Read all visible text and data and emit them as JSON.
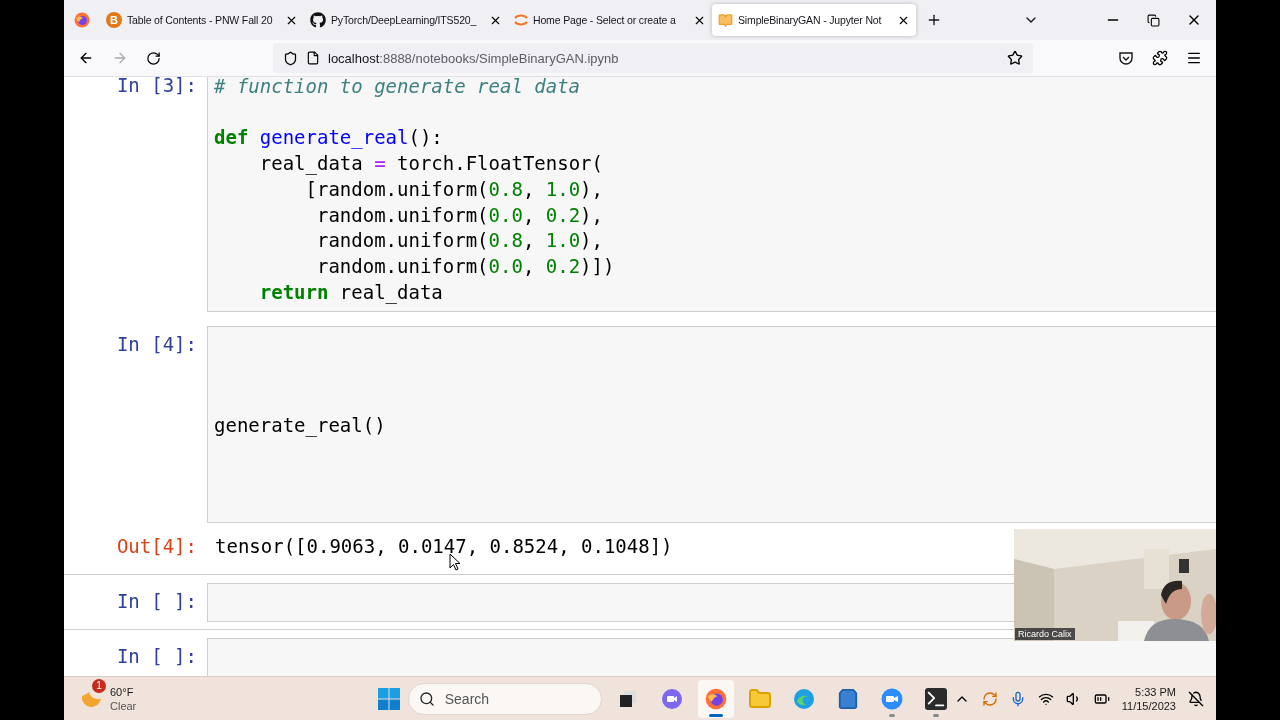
{
  "browser": {
    "tabs": [
      {
        "kind": "badge",
        "badge": "B",
        "title": "Table of Contents - PNW Fall 20",
        "selected": false
      },
      {
        "kind": "github",
        "title": "PyTorch/DeepLearning/ITS520_",
        "selected": false
      },
      {
        "kind": "jupyter",
        "title": "Home Page - Select or create a",
        "selected": false
      },
      {
        "kind": "notebook",
        "title": "SimpleBinaryGAN - Jupyter Not",
        "selected": true
      }
    ],
    "url": {
      "host": "localhost",
      "path": ":8888/notebooks/SimpleBinaryGAN.ipynb"
    }
  },
  "notebook": {
    "cells": [
      {
        "kind": "code",
        "prompt": "In [3]:",
        "lines": [
          {
            "tokens": [
              {
                "text": "# function to generate real data",
                "kind": "comment"
              }
            ]
          },
          {
            "blank_before": true,
            "tokens": [
              {
                "text": "def",
                "kind": "keyword"
              },
              {
                "text": " generate_real",
                "kind": "name"
              },
              {
                "text": "():",
                "kind": "plain"
              }
            ]
          },
          {
            "tokens": [
              {
                "text": "    real_data ",
                "kind": "plain"
              },
              {
                "text": "=",
                "kind": "operator"
              },
              {
                "text": " torch.FloatTensor(",
                "kind": "plain"
              }
            ]
          },
          {
            "tokens": [
              {
                "text": "        [random.uniform(",
                "kind": "plain"
              },
              {
                "text": "0.8",
                "kind": "number"
              },
              {
                "text": ", ",
                "kind": "plain"
              },
              {
                "text": "1.0",
                "kind": "number"
              },
              {
                "text": "),",
                "kind": "plain"
              }
            ]
          },
          {
            "tokens": [
              {
                "text": "         random.uniform(",
                "kind": "plain"
              },
              {
                "text": "0.0",
                "kind": "number"
              },
              {
                "text": ", ",
                "kind": "plain"
              },
              {
                "text": "0.2",
                "kind": "number"
              },
              {
                "text": "),",
                "kind": "plain"
              }
            ]
          },
          {
            "tokens": [
              {
                "text": "         random.uniform(",
                "kind": "plain"
              },
              {
                "text": "0.8",
                "kind": "number"
              },
              {
                "text": ", ",
                "kind": "plain"
              },
              {
                "text": "1.0",
                "kind": "number"
              },
              {
                "text": "),",
                "kind": "plain"
              }
            ]
          },
          {
            "tokens": [
              {
                "text": "         random.uniform(",
                "kind": "plain"
              },
              {
                "text": "0.0",
                "kind": "number"
              },
              {
                "text": ", ",
                "kind": "plain"
              },
              {
                "text": "0.2",
                "kind": "number"
              },
              {
                "text": ")])",
                "kind": "plain"
              }
            ]
          },
          {
            "tokens": [
              {
                "text": "    return",
                "kind": "keyword"
              },
              {
                "text": " real_data",
                "kind": "plain"
              }
            ]
          }
        ]
      },
      {
        "kind": "padded",
        "prompt": "In [4]:",
        "lines": [
          {
            "tokens": [
              {
                "text": "generate_real()",
                "kind": "plain"
              }
            ]
          }
        ],
        "output": {
          "prompt": "Out[4]:",
          "text": "tensor([0.9063, 0.0147, 0.8524, 0.1048])"
        }
      },
      {
        "kind": "code",
        "prompt": "In [ ]:"
      },
      {
        "kind": "code",
        "prompt": "In [ ]:"
      }
    ]
  },
  "video": {
    "kind": "picture",
    "name": "Ricardo Calix"
  },
  "taskbar": {
    "weather": {
      "badge": "1",
      "temperature": "60°F",
      "condition": "Clear"
    },
    "search": {
      "placeholder": "Search"
    },
    "apps": [
      {
        "kind": "taskview",
        "selected": false,
        "running": false
      },
      {
        "kind": "chat",
        "selected": false,
        "running": false
      },
      {
        "kind": "firefox",
        "selected": true,
        "running": true
      },
      {
        "kind": "folder",
        "selected": false,
        "running": false
      },
      {
        "kind": "edge",
        "selected": false,
        "running": false
      },
      {
        "kind": "store",
        "selected": false,
        "running": false
      },
      {
        "kind": "zoom",
        "selected": false,
        "running": true
      },
      {
        "kind": "terminal",
        "selected": false,
        "running": true
      }
    ],
    "time": "5:33 PM",
    "date": "11/15/2023"
  }
}
